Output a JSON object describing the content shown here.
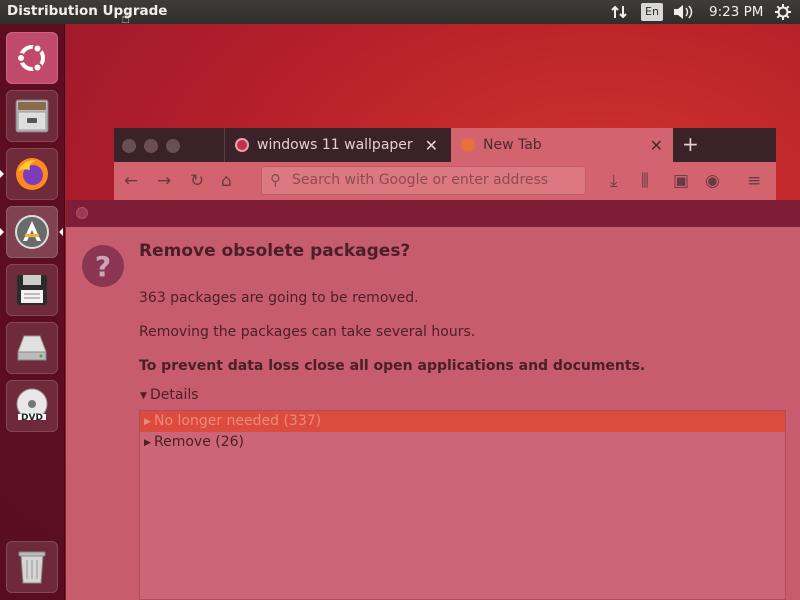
{
  "top_panel": {
    "app_title": "Distribution Upgrade",
    "language": "En",
    "clock": "9:23 PM"
  },
  "launcher": {
    "items": [
      "ubuntu-dash",
      "files",
      "firefox",
      "software-updater",
      "floppy-disk",
      "hard-disk",
      "dvd",
      "trash"
    ]
  },
  "firefox": {
    "tabs": [
      {
        "label": "windows 11 wallpaper"
      },
      {
        "label": "New Tab"
      }
    ],
    "url_placeholder": "Search with Google or enter address"
  },
  "dialog": {
    "heading": "Remove obsolete packages?",
    "line1": "363 packages are going to be removed.",
    "line2": "Removing the packages can take several hours.",
    "warning": "To prevent data loss close all open applications and documents.",
    "details_label": "Details",
    "rows": [
      {
        "label": "No longer needed (337)"
      },
      {
        "label": "Remove (26)"
      }
    ]
  },
  "colors": {
    "accent": "#dd4b3d",
    "dialog_bg": "#c75c6e",
    "panel_bg": "#2f2e2a"
  }
}
